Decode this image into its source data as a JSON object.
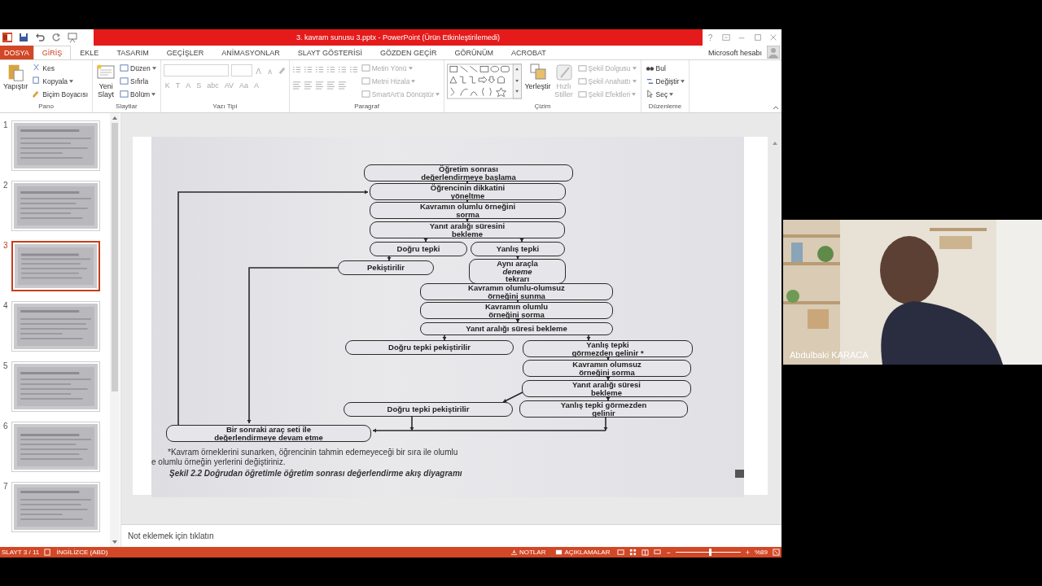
{
  "title_bar": {
    "title": "3. kavram sunusu 3.pptx - PowerPoint (Ürün Etkinleştirilemedi)",
    "help": "?"
  },
  "tabs": [
    {
      "label": "DOSYA",
      "kind": "file",
      "selected": false
    },
    {
      "label": "GİRİŞ",
      "kind": "tab",
      "selected": true
    },
    {
      "label": "EKLE",
      "kind": "tab",
      "selected": false
    },
    {
      "label": "TASARIM",
      "kind": "tab",
      "selected": false
    },
    {
      "label": "GEÇİŞLER",
      "kind": "tab",
      "selected": false
    },
    {
      "label": "ANİMASYONLAR",
      "kind": "tab",
      "selected": false
    },
    {
      "label": "SLAYT GÖSTERİSİ",
      "kind": "tab",
      "selected": false
    },
    {
      "label": "GÖZDEN GEÇİR",
      "kind": "tab",
      "selected": false
    },
    {
      "label": "GÖRÜNÜM",
      "kind": "tab",
      "selected": false
    },
    {
      "label": "ACROBAT",
      "kind": "tab",
      "selected": false
    }
  ],
  "account": {
    "label": "Microsoft hesabı"
  },
  "ribbon": {
    "clipboard": {
      "label": "Pano",
      "paste": "Yapıştır",
      "commands": [
        {
          "label": "Kes",
          "dropdown": false
        },
        {
          "label": "Kopyala",
          "dropdown": true
        },
        {
          "label": "Biçim Boyacısı",
          "dropdown": false
        }
      ]
    },
    "slides": {
      "label": "Slaytlar",
      "new_slide": "Yeni\nSlayt",
      "commands": [
        {
          "label": "Düzen",
          "dropdown": true
        },
        {
          "label": "Sıfırla",
          "dropdown": false
        },
        {
          "label": "Bölüm",
          "dropdown": true
        }
      ]
    },
    "font": {
      "label": "Yazı Tipi",
      "disabled": true,
      "format_buttons": [
        "K",
        "T",
        "A",
        "S",
        "abc",
        "AV",
        "Aa",
        "A"
      ]
    },
    "paragraph": {
      "label": "Paragraf",
      "commands": [
        {
          "label": "Metin Yönü",
          "disabled": true
        },
        {
          "label": "Metni Hizala",
          "disabled": true
        },
        {
          "label": "SmartArt'a Dönüştür",
          "disabled": true
        }
      ]
    },
    "drawing": {
      "label": "Çizim",
      "large": [
        {
          "label": "Yerleştir",
          "disabled": false
        },
        {
          "label": "Hızlı\nStiller",
          "disabled": true
        }
      ],
      "commands": [
        {
          "label": "Şekil Dolgusu",
          "disabled": true
        },
        {
          "label": "Şekil Anahattı",
          "disabled": true
        },
        {
          "label": "Şekil Efektleri",
          "disabled": true
        }
      ]
    },
    "editing": {
      "label": "Düzenleme",
      "commands": [
        {
          "label": "Bul",
          "dropdown": false
        },
        {
          "label": "Değiştir",
          "dropdown": true
        },
        {
          "label": "Seç",
          "dropdown": true
        }
      ]
    }
  },
  "thumbnails": [
    {
      "number": "1",
      "selected": false
    },
    {
      "number": "2",
      "selected": false
    },
    {
      "number": "3",
      "selected": true
    },
    {
      "number": "4",
      "selected": false
    },
    {
      "number": "5",
      "selected": false
    },
    {
      "number": "6",
      "selected": false
    },
    {
      "number": "7",
      "selected": false
    }
  ],
  "slide": {
    "nodes": [
      {
        "text": "Öğretim sonrası\ndeğerlendirmeye başlama"
      },
      {
        "text": "Öğrencinin dikkatini\nyöneltme"
      },
      {
        "text": "Kavramın olumlu örneğini\nsorma"
      },
      {
        "text": "Yanıt aralığı süresini\nbekleme"
      },
      {
        "text": "Doğru tepki"
      },
      {
        "text": "Yanlış tepki"
      },
      {
        "text": "Pekiştirilir"
      },
      {
        "text": "Aynı araçla\n*deneme*\ntekrarı"
      },
      {
        "text": "Kavramın olumlu-olumsuz\nörneğini sunma"
      },
      {
        "text": "Kavramın olumlu\nörneğini sorma"
      },
      {
        "text": "Yanıt aralığı süresi bekleme"
      },
      {
        "text": "Doğru tepki pekiştirilir"
      },
      {
        "text": "Yanlış tepki\ngörmezden gelinir *"
      },
      {
        "text": "Kavramın olumsuz\nörneğini sorma"
      },
      {
        "text": "Yanıt aralığı süresi\nbekleme"
      },
      {
        "text": "Doğru tepki pekiştirilir"
      },
      {
        "text": "Yanlış tepki görmezden\ngelinir"
      },
      {
        "text": "Bir sonraki araç seti ile\ndeğerlendirmeye devam etme"
      }
    ],
    "footnote": [
      "*Kavram örneklerini sunarken, öğrencinin tahmin edemeyeceği bir sıra ile olumlu",
      "e olumlu örneğin yerlerini değiştiriniz."
    ],
    "caption": "Şekil 2.2 Doğrudan öğretimle öğretim sonrası değerlendirme akış diyagramı"
  },
  "notes": {
    "placeholder": "Not eklemek için tıklatın"
  },
  "status_bar": {
    "slide": "SLAYT 3 / 11",
    "language": "İNGİLİZCE (ABD)",
    "notes": "NOTLAR",
    "comments": "AÇIKLAMALAR",
    "zoom": "%89",
    "zoom_out": "−",
    "zoom_in": "+",
    "zoom_slider": {
      "level": 0.53
    }
  },
  "video_tile": {
    "name": "Abdulbaki KARACA"
  }
}
